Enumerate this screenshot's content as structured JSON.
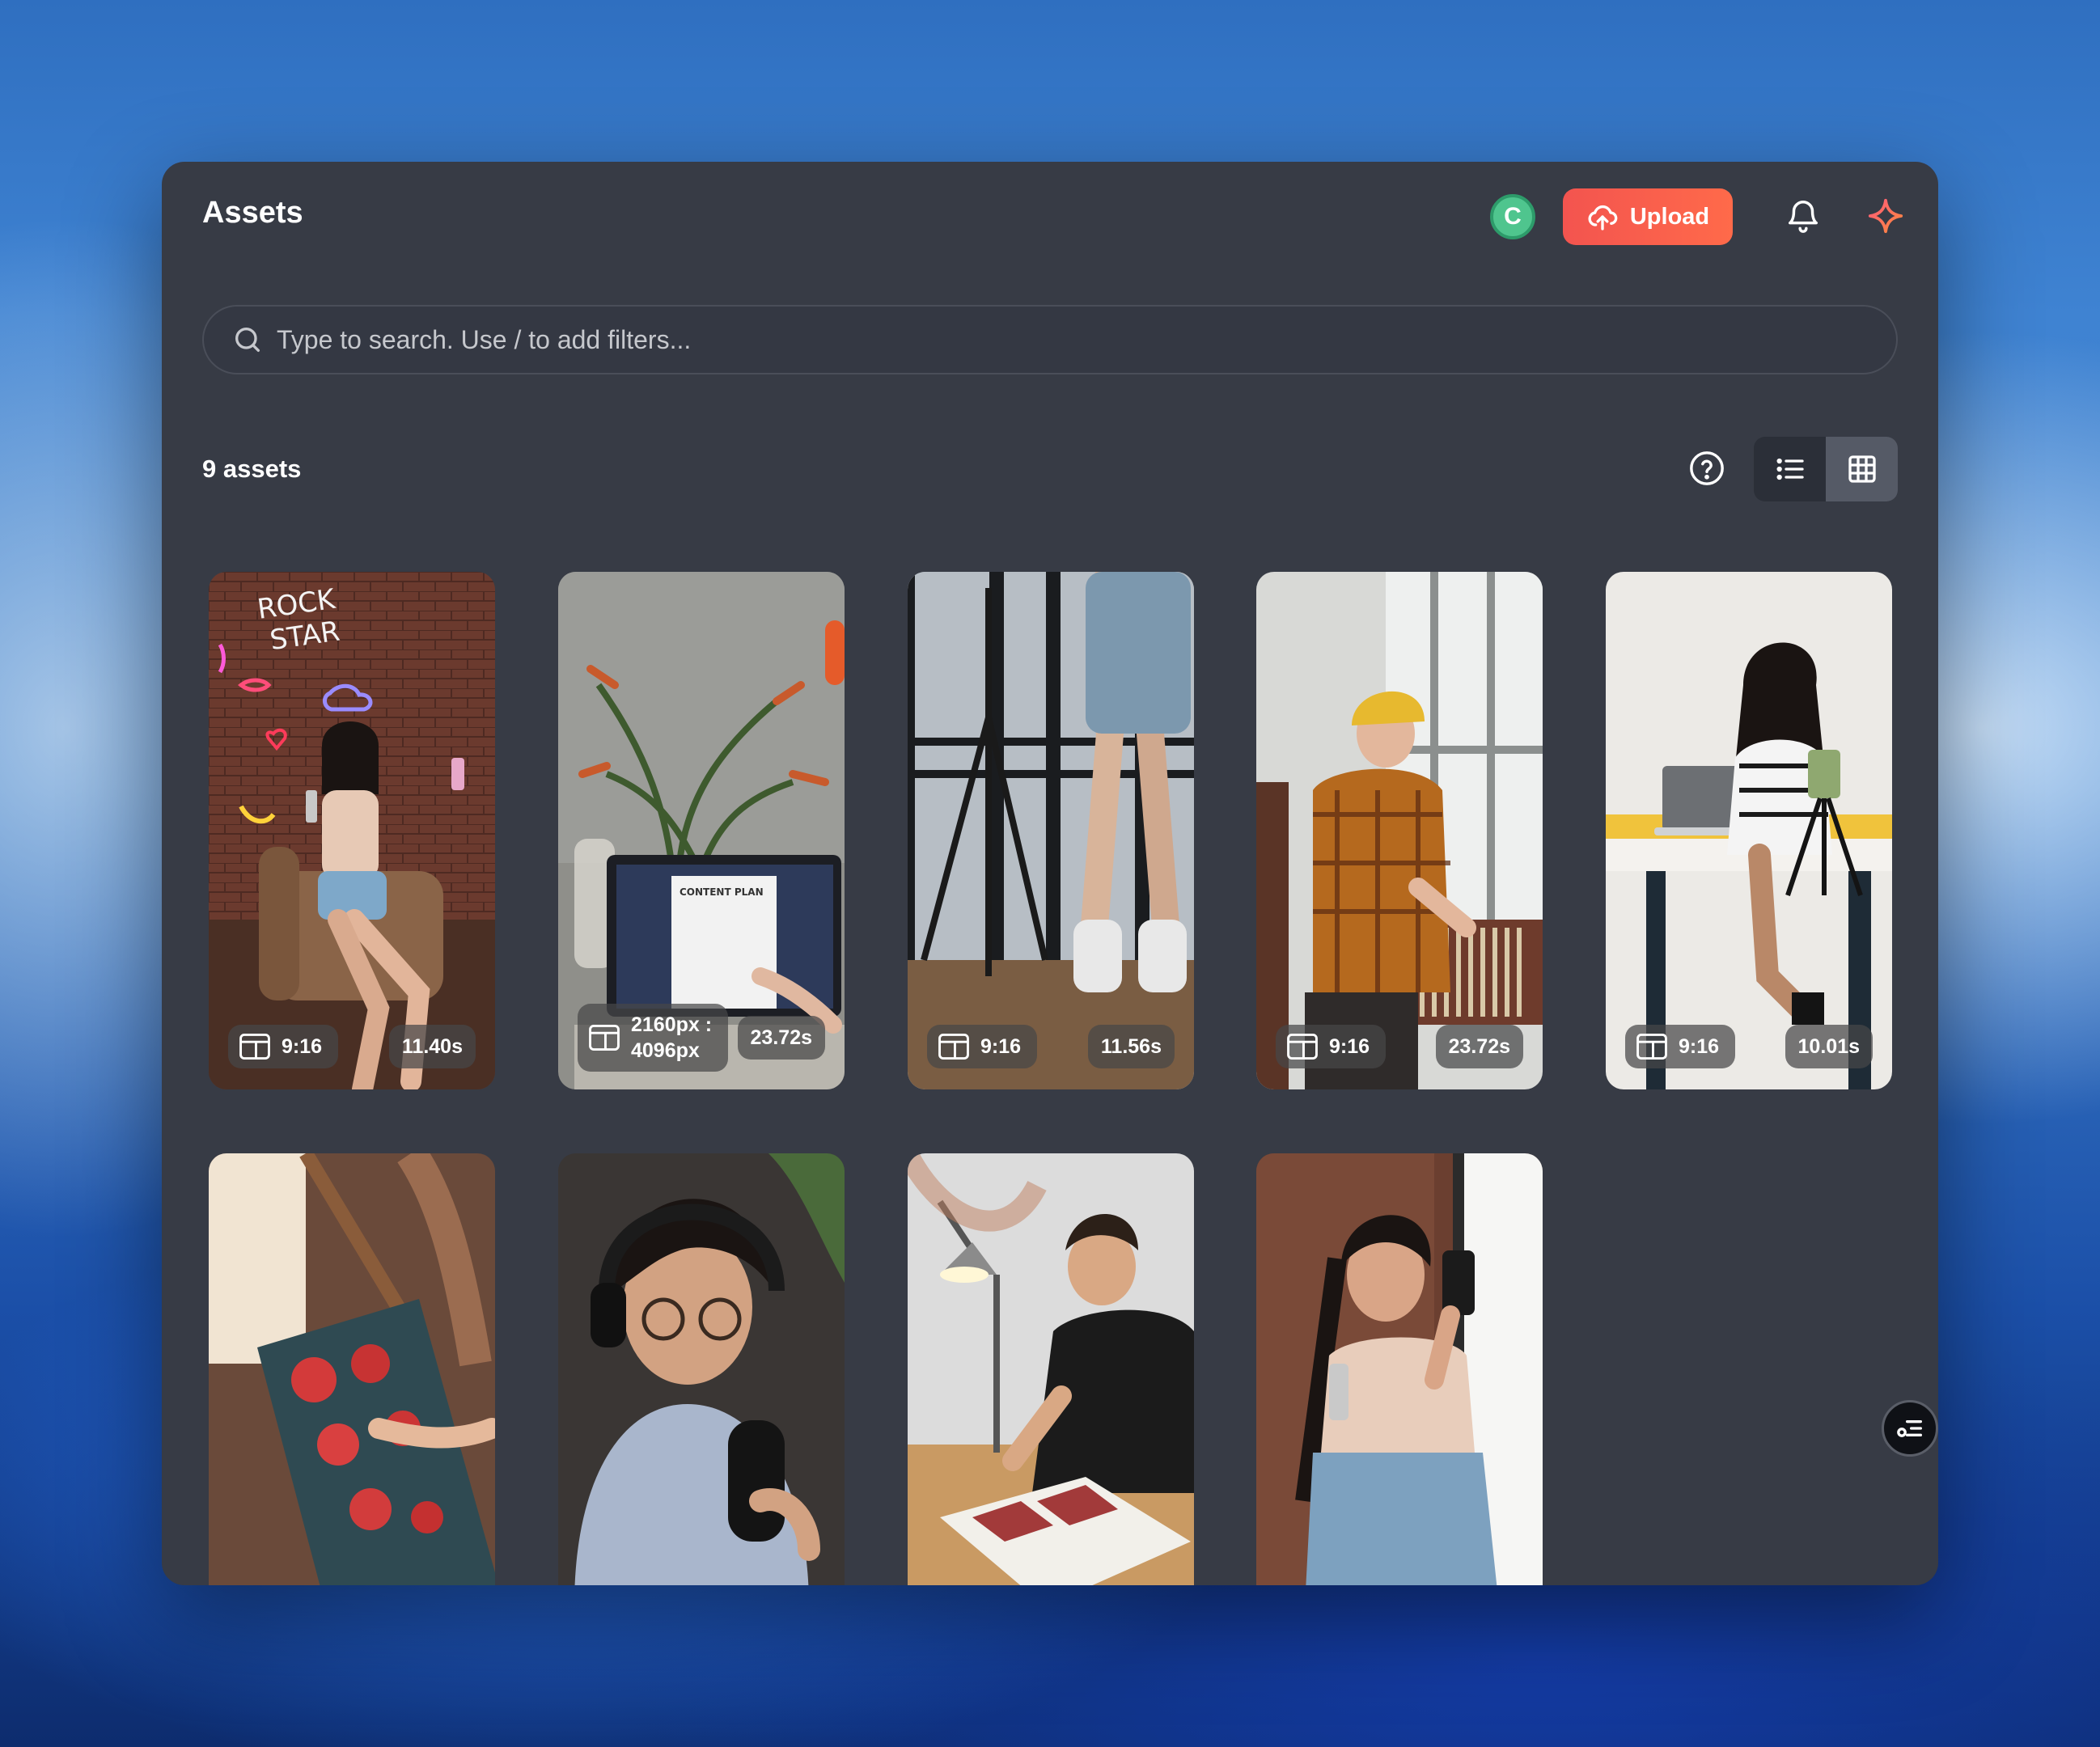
{
  "header": {
    "title": "Assets",
    "avatar_initial": "C",
    "upload_label": "Upload"
  },
  "search": {
    "placeholder": "Type to search. Use / to add filters..."
  },
  "toolbar": {
    "asset_count": "9 assets",
    "view_mode": "grid"
  },
  "assets": [
    {
      "ratio": "9:16",
      "duration": "11.40s",
      "scene": "woman taking selfie on armchair with neon ROCK STAR signs",
      "neon_text": "ROCK\nSTAR"
    },
    {
      "ratio": "2160px :\n4096px",
      "duration": "23.72s",
      "scene": "laptop showing content plan beside plant",
      "screen_text": "CONTENT PLAN"
    },
    {
      "ratio": "9:16",
      "duration": "11.56s",
      "scene": "legs and tripod by studio window"
    },
    {
      "ratio": "9:16",
      "duration": "23.72s",
      "scene": "man in yellow beanie browsing records"
    },
    {
      "ratio": "9:16",
      "duration": "10.01s",
      "scene": "woman filming at desk with laptop"
    },
    {
      "ratio": "",
      "duration": "",
      "scene": "painting red flowers on canvas"
    },
    {
      "ratio": "",
      "duration": "",
      "scene": "man with headphones and microphone"
    },
    {
      "ratio": "",
      "duration": "",
      "scene": "man sketching at desk under lamp"
    },
    {
      "ratio": "",
      "duration": "",
      "scene": "woman taking selfie by window"
    }
  ],
  "colors": {
    "panel_bg": "#373b45",
    "accent": "#f3544f",
    "avatar": "#4fc58e"
  }
}
